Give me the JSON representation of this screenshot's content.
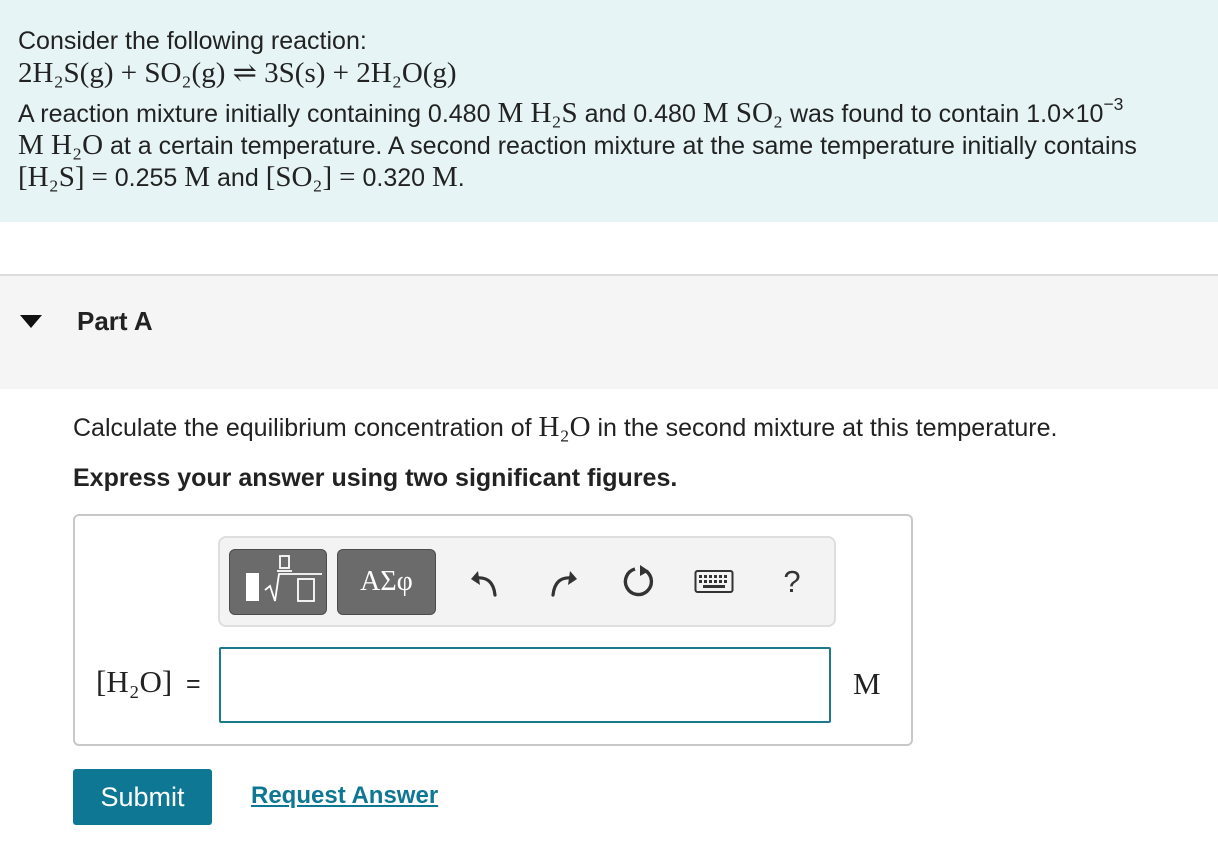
{
  "problem": {
    "intro": "Consider the following reaction:",
    "equation": {
      "reactant_1": "2H₂S(g)",
      "plus_1": "+",
      "reactant_2": "SO₂(g)",
      "arrow": "⇌",
      "product_1": "3S(s)",
      "plus_2": "+",
      "product_2": "2H₂O(g)"
    },
    "line3": {
      "text_1": "A reaction mixture initially containing 0.480",
      "unit_1": "M H₂S",
      "text_2": "and 0.480",
      "unit_2": "M SO₂",
      "text_3": "was found to contain 1.0×10",
      "exponent": "−3"
    },
    "line4": {
      "unit": "M H₂O",
      "text": "at a certain temperature. A second reaction mixture at the same temperature initially contains"
    },
    "line5": {
      "species_1": "[H₂S]",
      "equals_1": "=",
      "value_1": "0.255",
      "unit_1": "M",
      "and": "and",
      "species_2": "[SO₂]",
      "equals_2": "=",
      "value_2": "0.320",
      "unit_2": "M",
      "end": "."
    }
  },
  "part": {
    "title": "Part A"
  },
  "question": {
    "text_before": "Calculate the equilibrium concentration of",
    "species": "H₂O",
    "text_after": "in the second mixture at this temperature.",
    "instruction": "Express your answer using two significant figures."
  },
  "toolbar": {
    "symbols_label": "ΑΣφ",
    "help_label": "?"
  },
  "answer": {
    "variable": "[H₂O]",
    "equals": "=",
    "value": "",
    "unit": "M"
  },
  "actions": {
    "submit_label": "Submit",
    "request_answer_label": "Request Answer"
  },
  "colors": {
    "problem_background": "#e6f4f5",
    "accent": "#0d7794",
    "input_border": "#1c7a8a",
    "toolbar_button": "#6b6b6b"
  }
}
